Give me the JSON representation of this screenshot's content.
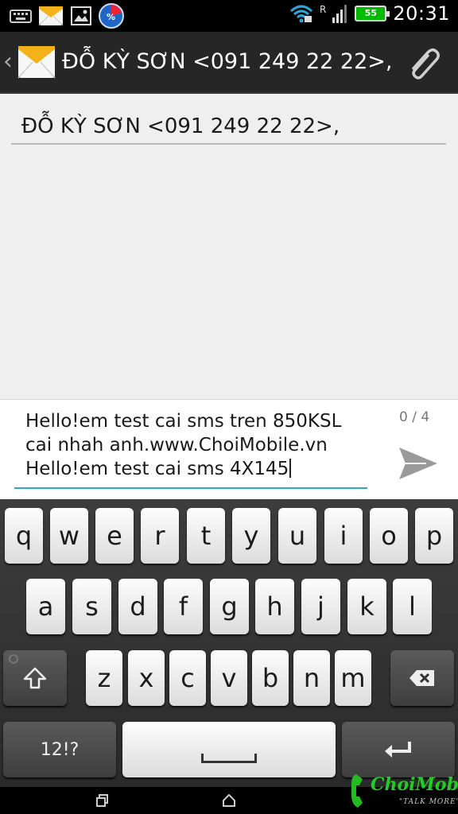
{
  "status_bar": {
    "time": "20:31",
    "battery_level": "55",
    "network_label": "R",
    "icons": [
      "keyboard-icon",
      "mail-notification-icon",
      "gallery-icon",
      "percent-app-icon",
      "wifi-icon",
      "signal-icon",
      "battery-icon"
    ]
  },
  "action_bar": {
    "title": "ĐỖ KỲ SƠN <091 249 22 22>,",
    "icons": [
      "back-chevron-icon",
      "messages-app-icon",
      "attachment-paperclip-icon"
    ]
  },
  "recipient": {
    "value": "ĐỖ KỲ SƠN <091 249 22 22>,"
  },
  "compose": {
    "lines": [
      "Hello!em test cai sms tren 850KSL",
      "cai nhah anh.www.ChoiMobile.vn",
      "Hello!em test cai sms 4X145"
    ],
    "counter": "0 / 4",
    "accent_color": "#29a7d8"
  },
  "keyboard": {
    "row1": [
      "q",
      "w",
      "e",
      "r",
      "t",
      "y",
      "u",
      "i",
      "o",
      "p"
    ],
    "row2": [
      "a",
      "s",
      "d",
      "f",
      "g",
      "h",
      "j",
      "k",
      "l"
    ],
    "row3": [
      "z",
      "x",
      "c",
      "v",
      "b",
      "n",
      "m"
    ],
    "symbols_label": "12!?",
    "icons": [
      "shift-icon",
      "backspace-icon",
      "space-icon",
      "enter-icon"
    ]
  },
  "watermark": {
    "brand": "ChoiMobile",
    "tagline": "\"TALK MORE\""
  }
}
